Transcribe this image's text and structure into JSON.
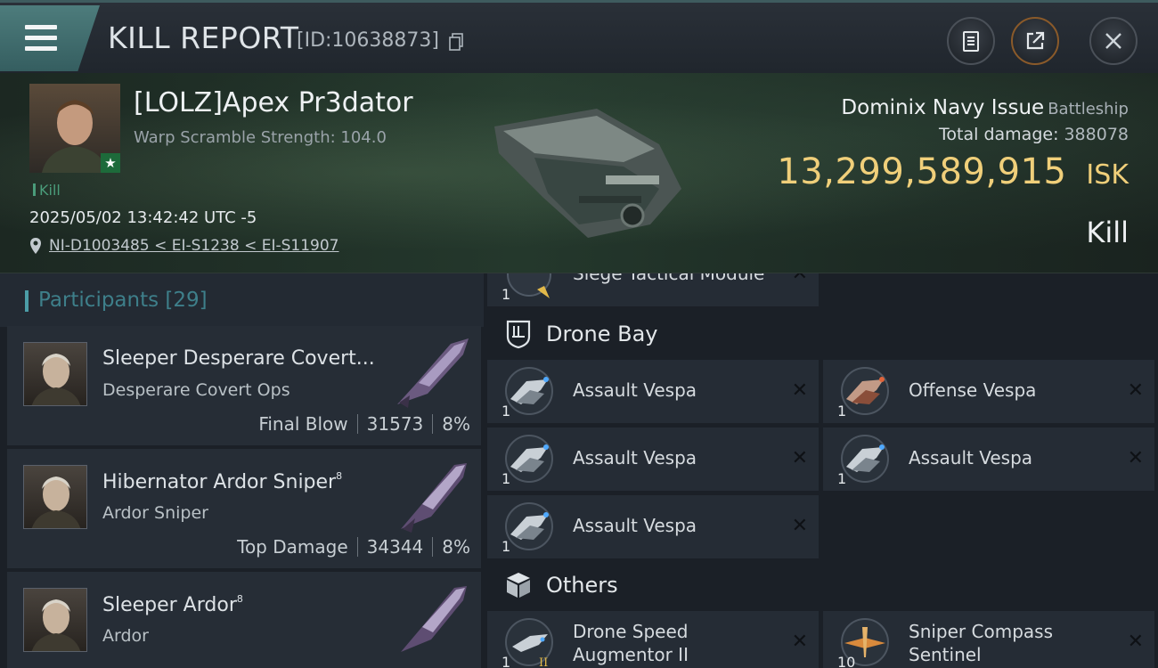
{
  "header": {
    "title": "KILL REPORT",
    "report_id": "[ID:10638873]"
  },
  "victim": {
    "pilot_name": "[LOLZ]Apex Pr3dator",
    "warp_scramble": "Warp Scramble Strength: 104.0",
    "kill_tag": "Kill",
    "datetime": "2025/05/02 13:42:42 UTC -5",
    "location": "NI-D1003485 < EI-S1238 < EI-S11907",
    "ship_name": "Dominix Navy Issue",
    "ship_class": "Battleship",
    "total_damage_label": "Total damage:",
    "total_damage": "388078",
    "isk_value": "13,299,589,915",
    "isk_unit": "ISK",
    "result_label": "Kill"
  },
  "participants": {
    "label": "Participants",
    "count": "[29]",
    "items": [
      {
        "name": "Sleeper Desperare Covert...",
        "ship": "Desperare Covert Ops",
        "role": "Final Blow",
        "damage": "31573",
        "percent": "8%"
      },
      {
        "name": "Hibernator Ardor Sniper",
        "level": "8",
        "ship": "Ardor Sniper",
        "role": "Top Damage",
        "damage": "34344",
        "percent": "8%"
      },
      {
        "name": "Sleeper Ardor",
        "level": "8",
        "ship": "Ardor"
      }
    ]
  },
  "fittings": {
    "partial_top": {
      "name": "Siege Tactical Module",
      "qty": "1"
    },
    "drone_bay": {
      "label": "Drone Bay",
      "items": [
        {
          "name": "Assault Vespa",
          "qty": "1"
        },
        {
          "name": "Offense  Vespa",
          "qty": "1"
        },
        {
          "name": "Assault Vespa",
          "qty": "1"
        },
        {
          "name": "Assault Vespa",
          "qty": "1"
        },
        {
          "name": "Assault Vespa",
          "qty": "1"
        }
      ]
    },
    "others": {
      "label": "Others",
      "items": [
        {
          "name_line1": "Drone Speed",
          "name_line2": "Augmentor II",
          "qty": "1"
        },
        {
          "name_line1": "Sniper Compass",
          "name_line2": "Sentinel",
          "qty": "10"
        }
      ]
    },
    "remove_glyph": "✕"
  },
  "colors": {
    "accent_teal": "#4d7c7c",
    "isk_gold": "#f0cf7a",
    "kill_green": "#4a9c7a"
  }
}
